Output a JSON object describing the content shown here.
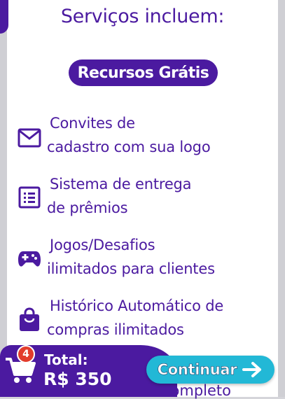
{
  "section_title": "Serviços incluem:",
  "badge_pill": "Recursos Grátis",
  "features": [
    {
      "icon": "mail-icon",
      "line1": "Convites de",
      "line2": "cadastro com sua logo"
    },
    {
      "icon": "list-icon",
      "line1": "Sistema de entrega",
      "line2": "de prêmios"
    },
    {
      "icon": "gamepad-icon",
      "line1": "Jogos/Desafios",
      "line2": "ilimitados para clientes"
    },
    {
      "icon": "shopping-bag-icon",
      "line1": "Histórico Automático de",
      "line2": "compras ilimitados"
    }
  ],
  "peek_text": "completo",
  "cart": {
    "count": "4",
    "total_label": "Total:",
    "total_value": "R$ 350"
  },
  "continue_label": "Continuar",
  "colors": {
    "primary": "#4b1aa0",
    "accent": "#22b8d6",
    "badge": "#e23c2c"
  }
}
